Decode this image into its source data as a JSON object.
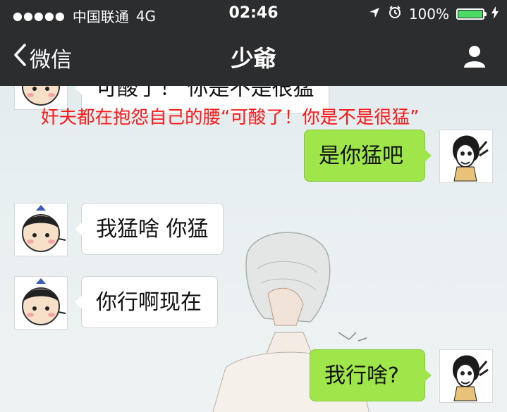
{
  "status_bar": {
    "carrier": "中国联通",
    "network": "4G",
    "time": "02:46",
    "battery": "100%",
    "battery_color": "#4cd964"
  },
  "nav": {
    "back_label": "微信",
    "title": "少爺",
    "icons": {
      "back": "chevron-left-icon",
      "contact": "person-icon"
    }
  },
  "caption": "奸夫都在抱怨自己的腰“可酸了！你是不是很猛”",
  "messages": [
    {
      "side": "in",
      "text": "可酸了！ 你是不是很猛"
    },
    {
      "side": "out",
      "text": "是你猛吧"
    },
    {
      "side": "in",
      "text": "我猛啥 你猛"
    },
    {
      "side": "in",
      "text": "你行啊现在"
    },
    {
      "side": "out",
      "text": "我行啥?"
    }
  ],
  "colors": {
    "nav_bg": "#2b2d2f",
    "bubble_out": "#9ee64a",
    "bubble_in": "#ffffff",
    "caption": "#ff1a1a"
  }
}
